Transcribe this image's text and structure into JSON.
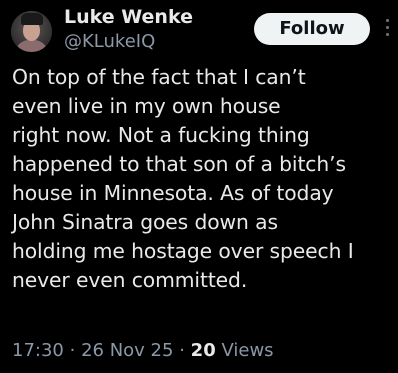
{
  "author": {
    "name": "Luke Wenke",
    "handle": "@KLukeIQ",
    "avatar_icon": "profile-photo"
  },
  "follow_button": {
    "label": "Follow"
  },
  "more_menu": {
    "icon": "more-vertical-icon"
  },
  "tweet": {
    "text": "On top of the fact that I can’t\neven live in my own house\nright now.  Not a fucking thing\nhappened to that son of a bitch’s\nhouse in Minnesota.  As of today\nJohn Sinatra goes down as\nholding me hostage over speech I\nnever even committed.",
    "time": "17:30",
    "date": "26 Nov 25",
    "views_count": "20",
    "views_label": "Views",
    "separator": "·"
  },
  "colors": {
    "background": "#000000",
    "primary_text": "#e7e9ea",
    "secondary_text": "#8b98a5",
    "button_bg": "#eff3f4",
    "button_text": "#0f1419"
  }
}
